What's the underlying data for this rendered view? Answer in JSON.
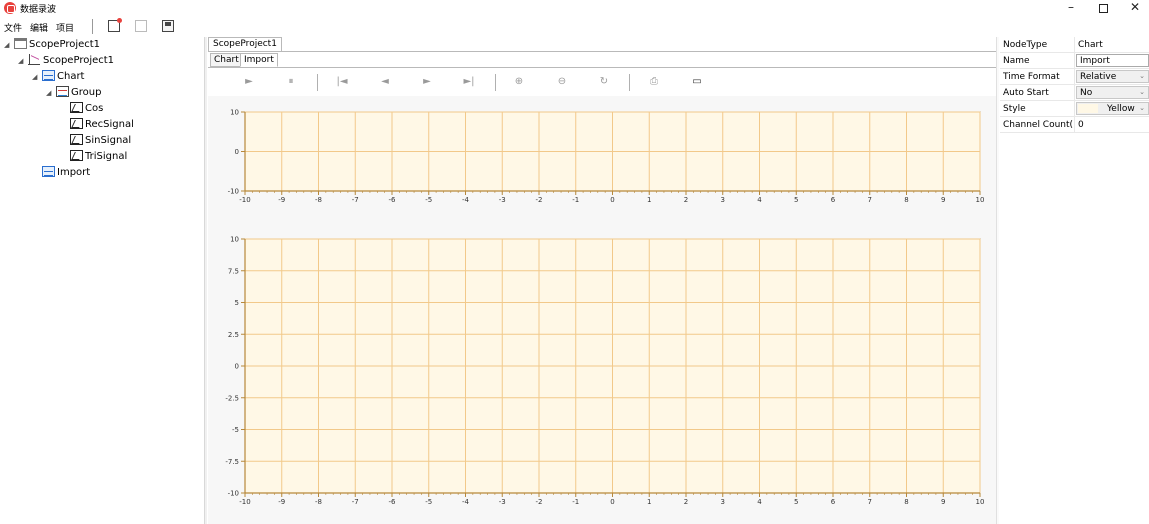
{
  "window": {
    "title": "数据录波",
    "minimize_glyph": "–",
    "close_glyph": "✕"
  },
  "menu": [
    "文件",
    "编辑",
    "项目"
  ],
  "toolbar": [
    "add-chart-icon",
    "chart-disabled-icon",
    "save-icon"
  ],
  "tree": {
    "nodes": [
      {
        "label": "ScopeProject1",
        "icon": "folder-icon"
      },
      {
        "label": "ScopeProject1",
        "icon": "project-icon"
      },
      {
        "label": "Chart",
        "icon": "chart-icon"
      },
      {
        "label": "Group",
        "icon": "group-icon"
      },
      {
        "label": "Cos",
        "icon": "signal-icon"
      },
      {
        "label": "RecSignal",
        "icon": "signal-icon"
      },
      {
        "label": "SinSignal",
        "icon": "signal-icon"
      },
      {
        "label": "TriSignal",
        "icon": "signal-icon"
      },
      {
        "label": "Import",
        "icon": "chart-icon"
      }
    ]
  },
  "document": {
    "tab": "ScopeProject1",
    "subtabs": [
      "Chart",
      "Import"
    ],
    "active_subtab": "Import"
  },
  "controls": {
    "play": "►",
    "pause": "⏸",
    "first": "|◄",
    "prev": "◄",
    "next": "►",
    "last": "►|",
    "zoom_in": "⊕",
    "zoom_out": "⊖",
    "reset": "↻",
    "export": "⎙",
    "open": "▭"
  },
  "colors": {
    "plot_bg": "#fff8e6",
    "grid": "#f2c98a",
    "axis": "#b7883a",
    "accent": "#e8413c"
  },
  "chart_data": [
    {
      "type": "line",
      "x_ticks": [
        "-10",
        "-9",
        "-8",
        "-7",
        "-6",
        "-5",
        "-4",
        "-3",
        "-2",
        "-1",
        "0",
        "1",
        "2",
        "3",
        "4",
        "5",
        "6",
        "7",
        "8",
        "9",
        "10"
      ],
      "y_ticks": [
        "10",
        "0",
        "-10"
      ],
      "xlim": [
        -10,
        10
      ],
      "ylim": [
        -10,
        10
      ],
      "grid": true,
      "series": []
    },
    {
      "type": "line",
      "x_ticks": [
        "-10",
        "-9",
        "-8",
        "-7",
        "-6",
        "-5",
        "-4",
        "-3",
        "-2",
        "-1",
        "0",
        "1",
        "2",
        "3",
        "4",
        "5",
        "6",
        "7",
        "8",
        "9",
        "10"
      ],
      "y_ticks": [
        "10",
        "7.5",
        "5",
        "2.5",
        "0",
        "-2.5",
        "-5",
        "-7.5",
        "-10"
      ],
      "xlim": [
        -10,
        10
      ],
      "ylim": [
        -10,
        10
      ],
      "grid": true,
      "series": []
    }
  ],
  "properties": [
    {
      "key": "NodeType",
      "value": "Chart",
      "kind": "text"
    },
    {
      "key": "Name",
      "value": "Import",
      "kind": "input"
    },
    {
      "key": "Time Format",
      "value": "Relative",
      "kind": "select"
    },
    {
      "key": "Auto Start",
      "value": "No",
      "kind": "select"
    },
    {
      "key": "Style",
      "value": "Yellow",
      "kind": "color-select"
    },
    {
      "key": "Channel Count(M:",
      "value": "0",
      "kind": "text"
    }
  ]
}
